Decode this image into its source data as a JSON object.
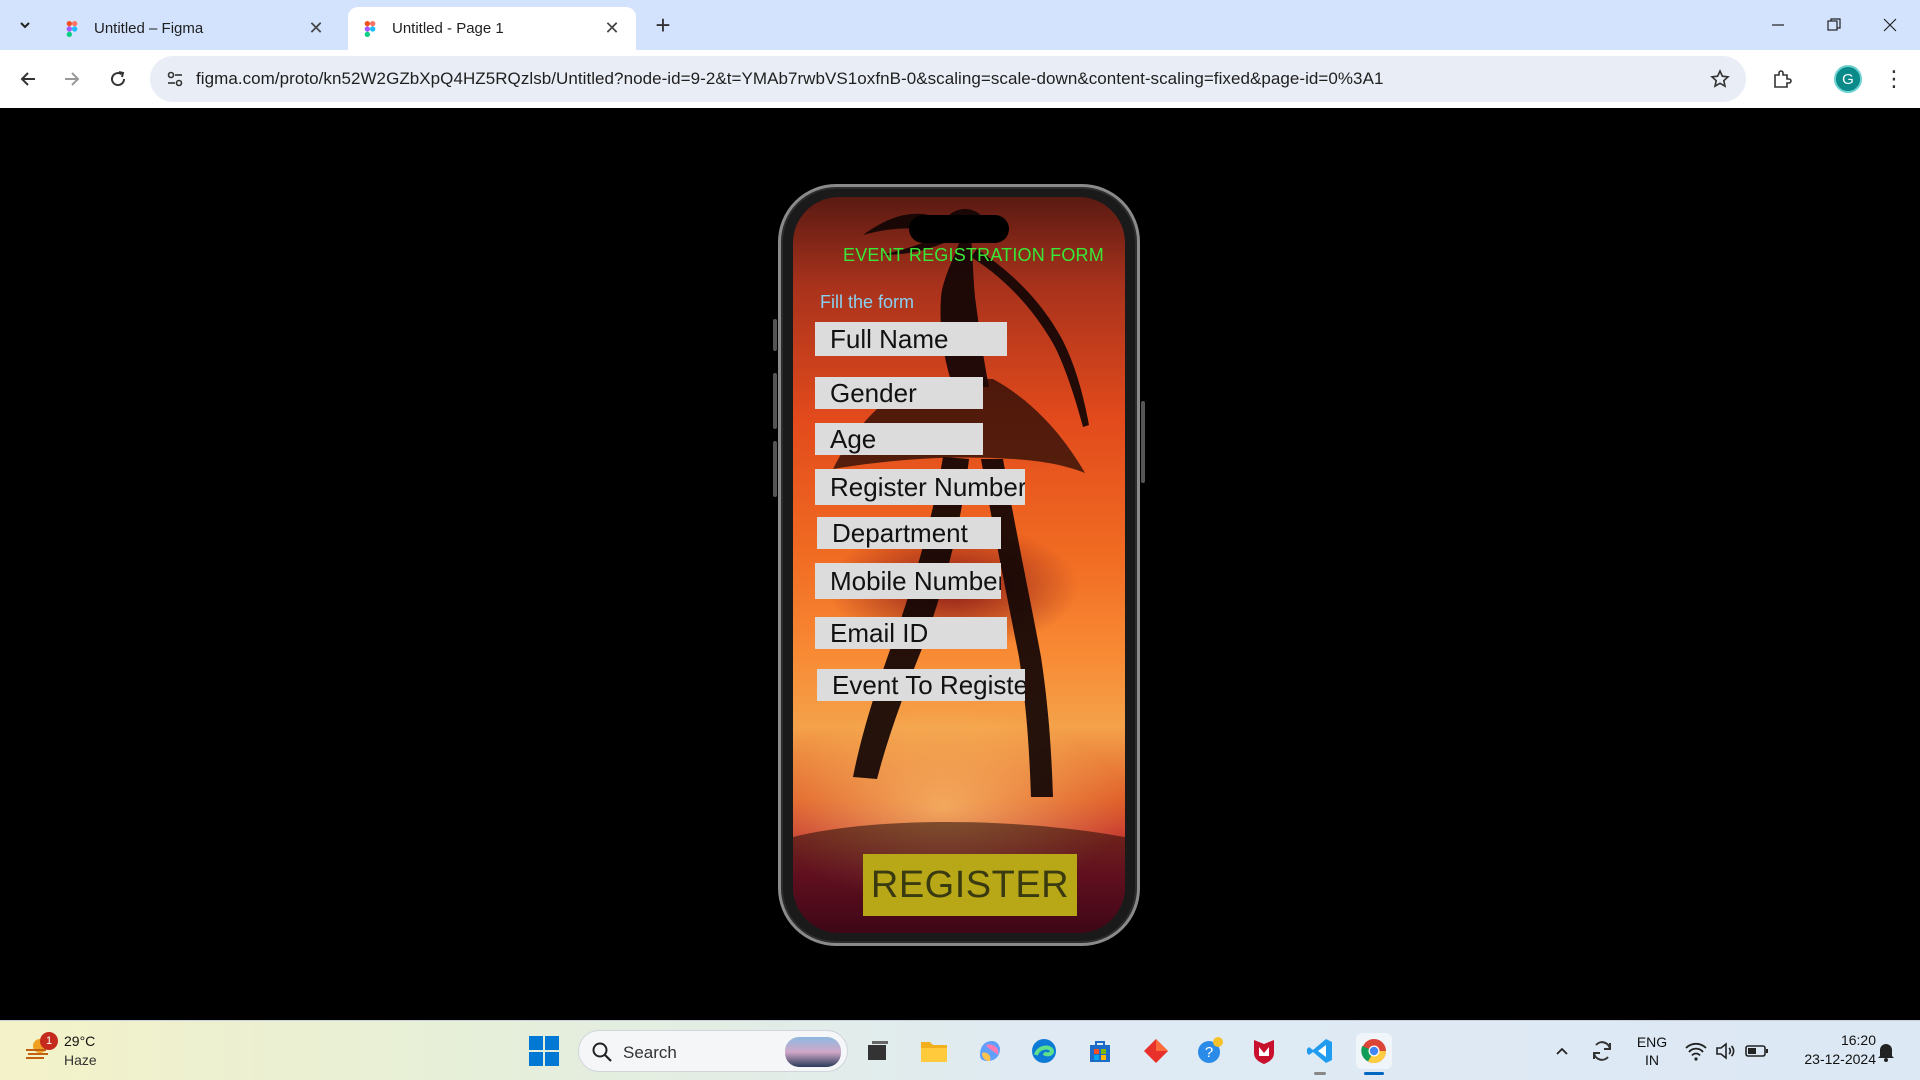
{
  "browser": {
    "tabs": [
      {
        "title": "Untitled – Figma",
        "active": false
      },
      {
        "title": "Untitled - Page 1",
        "active": true
      }
    ],
    "url": "figma.com/proto/kn52W2GZbXpQ4HZ5RQzlsb/Untitled?node-id=9-2&t=YMAb7rwbVS1oxfnB-0&scaling=scale-down&content-scaling=fixed&page-id=0%3A1",
    "profile_initial": "G"
  },
  "form": {
    "title": "EVENT REGISTRATION FORM",
    "subtitle": "Fill the form",
    "fields": [
      {
        "label": "Full Name"
      },
      {
        "label": "Gender"
      },
      {
        "label": "Age"
      },
      {
        "label": "Register Number"
      },
      {
        "label": "Department"
      },
      {
        "label": "Mobile Number"
      },
      {
        "label": "Email ID"
      },
      {
        "label": "Event To Register"
      }
    ],
    "submit_label": "REGISTER",
    "colors": {
      "title": "#38e838",
      "subtitle": "#8ad0f0",
      "field_bg": "#dcdcdc",
      "button_bg": "#b8a818",
      "button_text": "#3a3a10"
    }
  },
  "taskbar": {
    "weather": {
      "temp": "29°C",
      "condition": "Haze",
      "badge": "1"
    },
    "search_label": "Search",
    "apps": [
      "task-view-icon",
      "file-explorer-icon",
      "copilot-icon",
      "edge-icon",
      "microsoft-store-icon",
      "app-red-diamond-icon",
      "app-help-icon",
      "mcafee-icon",
      "vscode-icon",
      "chrome-icon"
    ],
    "language": {
      "line1": "ENG",
      "line2": "IN"
    },
    "time": "16:20",
    "date": "23-12-2024"
  }
}
